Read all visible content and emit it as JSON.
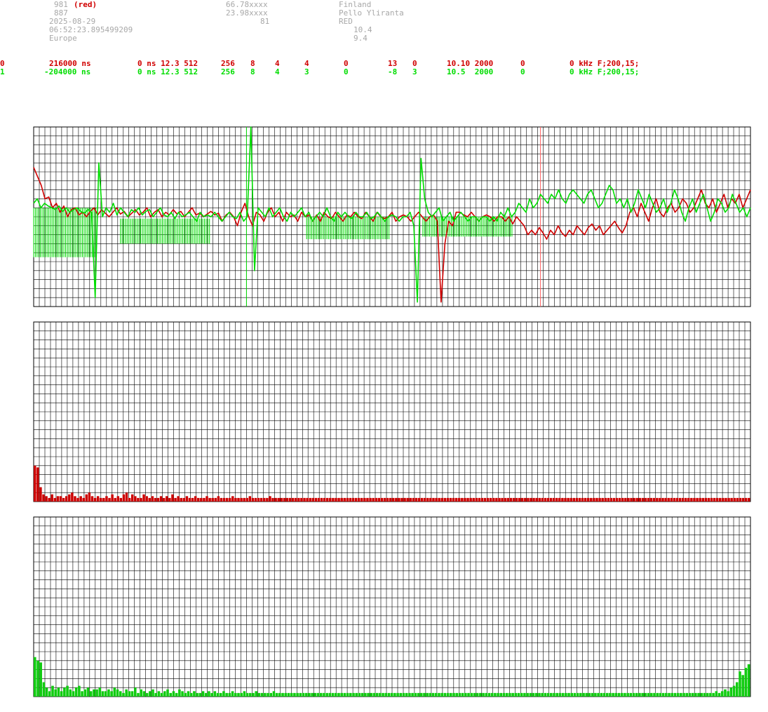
{
  "header": {
    "col1": [
      "981",
      "887",
      "2025-08-29",
      "06:52:23.895499209",
      "Europe"
    ],
    "red_tag": "(red)",
    "col2": [
      "66.78xxxx",
      "23.98xxxx",
      "81"
    ],
    "col3": [
      "Finland",
      "Pello Yliranta",
      "RED"
    ],
    "col3b": [
      "10.4",
      "9.4"
    ]
  },
  "channels": [
    {
      "id": "0",
      "offset": "216000 ns",
      "f1": "0 ns 12.3 512",
      "f2": "256",
      "f3": "8",
      "f4": "4",
      "f5": "4",
      "f6": "0",
      "f7": "13",
      "f8": "0",
      "f9": "10.10 2000",
      "f10": "0",
      "f11": "0 kHz F;200,15;",
      "color": "#d00000"
    },
    {
      "id": "1",
      "offset": "-204000 ns",
      "f1": "0 ns 12.3 512",
      "f2": "256",
      "f3": "8",
      "f4": "4",
      "f5": "3",
      "f6": "0",
      "f7": "-8",
      "f8": "3",
      "f9": "10.5  2000",
      "f10": "0",
      "f11": "0 kHz F;200,15;",
      "color": "#00dd00"
    }
  ],
  "chart_data": [
    {
      "type": "line",
      "ylim": [
        -1,
        1
      ],
      "xlim": [
        0,
        512
      ],
      "grid": true,
      "markers": {
        "red_x": 362,
        "green_x": 152
      },
      "series": [
        {
          "color": "#d00000",
          "values": [
            0.55,
            0.45,
            0.35,
            0.2,
            0.22,
            0.1,
            0.15,
            0.05,
            0.12,
            0.0,
            0.08,
            0.1,
            0.02,
            0.05,
            0.0,
            0.06,
            0.1,
            0.02,
            0.08,
            0.04,
            0.0,
            0.05,
            0.1,
            0.03,
            0.06,
            0.0,
            0.04,
            0.08,
            0.02,
            0.05,
            0.1,
            0.0,
            0.05,
            0.08,
            0.0,
            0.05,
            0.02,
            0.08,
            0.03,
            0.06,
            0.0,
            0.05,
            0.1,
            0.02,
            0.04,
            0.0,
            0.03,
            0.06,
            0.02,
            0.04,
            -0.05,
            0.02,
            0.05,
            0.0,
            -0.1,
            0.05,
            0.15,
            0.0,
            -0.1,
            0.05,
            0.02,
            -0.05,
            0.05,
            0.1,
            0.0,
            0.05,
            -0.05,
            0.05,
            0.0,
            0.02,
            -0.05,
            0.05,
            0.0,
            0.02,
            -0.05,
            0.02,
            -0.05,
            0.05,
            0.0,
            -0.02,
            0.05,
            0.0,
            -0.05,
            0.02,
            0.0,
            0.05,
            0.0,
            -0.02,
            0.05,
            0.0,
            -0.05,
            0.05,
            0.0,
            -0.02,
            0.0,
            0.05,
            -0.05,
            0.0,
            0.02,
            0.0,
            -0.05,
            0.0,
            0.05,
            0.0,
            -0.05,
            0.0,
            0.02,
            -0.05,
            -0.95,
            -0.3,
            -0.05,
            -0.1,
            0.05,
            0.05,
            0.02,
            0.0,
            0.05,
            0.0,
            -0.05,
            0.0,
            0.02,
            0.0,
            -0.05,
            0.0,
            0.0,
            -0.05,
            0.0,
            -0.08,
            0.0,
            -0.05,
            -0.1,
            -0.2,
            -0.15,
            -0.2,
            -0.12,
            -0.18,
            -0.25,
            -0.15,
            -0.2,
            -0.1,
            -0.18,
            -0.22,
            -0.15,
            -0.2,
            -0.1,
            -0.15,
            -0.2,
            -0.12,
            -0.08,
            -0.15,
            -0.1,
            -0.2,
            -0.15,
            -0.1,
            -0.05,
            -0.12,
            -0.18,
            -0.1,
            0.05,
            0.1,
            0.0,
            0.15,
            0.05,
            -0.05,
            0.1,
            0.2,
            0.05,
            0.0,
            0.1,
            0.15,
            0.05,
            0.1,
            0.2,
            0.15,
            0.05,
            0.1,
            0.2,
            0.3,
            0.15,
            0.1,
            0.2,
            0.05,
            0.15,
            0.25,
            0.1,
            0.2,
            0.15,
            0.25,
            0.1,
            0.2,
            0.3
          ]
        },
        {
          "color": "#00dd00",
          "values": [
            0.15,
            0.2,
            0.1,
            0.15,
            0.12,
            0.1,
            0.08,
            0.12,
            0.06,
            0.1,
            0.05,
            0.08,
            0.1,
            0.06,
            0.04,
            0.08,
            0.05,
            -0.9,
            0.6,
            0.0,
            0.1,
            0.05,
            0.15,
            0.02,
            0.1,
            0.05,
            0.0,
            0.08,
            0.05,
            0.1,
            0.02,
            0.06,
            0.08,
            0.0,
            0.05,
            0.1,
            0.02,
            0.0,
            0.05,
            -0.02,
            0.05,
            0.0,
            0.02,
            0.05,
            0.0,
            -0.05,
            0.05,
            0.0,
            0.02,
            0.0,
            0.05,
            0.0,
            -0.05,
            0.0,
            0.05,
            0.0,
            -0.02,
            0.05,
            -0.05,
            0.0,
            1.0,
            -0.6,
            0.1,
            0.05,
            0.0,
            0.1,
            0.0,
            0.05,
            0.1,
            0.0,
            -0.05,
            0.05,
            0.0,
            0.05,
            0.1,
            0.0,
            0.05,
            -0.05,
            0.0,
            0.05,
            0.0,
            0.1,
            0.0,
            -0.05,
            0.05,
            0.0,
            0.05,
            0.0,
            -0.02,
            0.05,
            0.0,
            0.0,
            0.05,
            -0.02,
            0.0,
            0.05,
            0.0,
            -0.05,
            0.0,
            0.02,
            0.0,
            -0.05,
            0.0,
            0.0,
            0.05,
            -0.1,
            -0.95,
            0.65,
            0.2,
            0.05,
            0.0,
            0.05,
            0.1,
            -0.05,
            0.0,
            0.05,
            -0.05,
            0.0,
            0.05,
            0.0,
            -0.05,
            0.0,
            0.0,
            -0.05,
            0.0,
            0.0,
            -0.05,
            0.0,
            -0.05,
            0.05,
            0.0,
            0.1,
            0.0,
            0.05,
            0.15,
            0.1,
            0.05,
            0.2,
            0.1,
            0.15,
            0.25,
            0.2,
            0.15,
            0.25,
            0.2,
            0.3,
            0.2,
            0.15,
            0.25,
            0.3,
            0.25,
            0.2,
            0.15,
            0.25,
            0.3,
            0.2,
            0.1,
            0.15,
            0.25,
            0.35,
            0.3,
            0.15,
            0.2,
            0.1,
            0.2,
            0.05,
            0.15,
            0.3,
            0.2,
            0.1,
            0.25,
            0.15,
            0.05,
            0.1,
            0.2,
            0.05,
            0.15,
            0.3,
            0.2,
            0.05,
            -0.05,
            0.1,
            0.2,
            0.05,
            0.15,
            0.25,
            0.1,
            -0.05,
            0.05,
            0.2,
            0.15,
            0.05,
            0.1,
            0.25,
            0.15,
            0.05,
            0.1,
            0.0,
            0.1
          ]
        }
      ],
      "bursts": [
        {
          "color": "#00dd00",
          "from": 0,
          "to": 45,
          "lo": -0.45,
          "hi": 0.1
        },
        {
          "color": "#00dd00",
          "from": 62,
          "to": 126,
          "lo": -0.3,
          "hi": -0.02
        },
        {
          "color": "#00dd00",
          "from": 195,
          "to": 254,
          "lo": -0.25,
          "hi": 0.0
        },
        {
          "color": "#00dd00",
          "from": 278,
          "to": 342,
          "lo": -0.22,
          "hi": 0.0
        }
      ]
    },
    {
      "type": "bar",
      "ylim": [
        0,
        1
      ],
      "grid": true,
      "color": "#cc0000",
      "values": [
        0.2,
        0.19,
        0.08,
        0.04,
        0.03,
        0.02,
        0.04,
        0.02,
        0.03,
        0.03,
        0.02,
        0.03,
        0.04,
        0.05,
        0.03,
        0.02,
        0.03,
        0.02,
        0.04,
        0.05,
        0.03,
        0.02,
        0.03,
        0.02,
        0.02,
        0.03,
        0.02,
        0.04,
        0.02,
        0.03,
        0.02,
        0.04,
        0.05,
        0.02,
        0.04,
        0.03,
        0.02,
        0.02,
        0.04,
        0.03,
        0.02,
        0.03,
        0.02,
        0.02,
        0.03,
        0.02,
        0.03,
        0.02,
        0.04,
        0.02,
        0.03,
        0.02,
        0.02,
        0.03,
        0.02,
        0.02,
        0.03,
        0.02,
        0.02,
        0.02,
        0.03,
        0.02,
        0.02,
        0.02,
        0.03,
        0.02,
        0.02,
        0.02,
        0.02,
        0.03,
        0.02,
        0.02,
        0.02,
        0.02,
        0.02,
        0.03,
        0.02,
        0.02,
        0.02,
        0.02,
        0.02,
        0.02,
        0.03,
        0.02,
        0.02,
        0.02,
        0.02,
        0.02,
        0.02,
        0.02,
        0.02,
        0.02,
        0.02,
        0.02,
        0.02,
        0.02,
        0.02,
        0.02,
        0.02,
        0.02,
        0.02,
        0.02,
        0.02,
        0.02,
        0.02,
        0.02,
        0.02,
        0.02,
        0.02,
        0.02,
        0.02,
        0.02,
        0.02,
        0.02,
        0.02,
        0.02,
        0.02,
        0.02,
        0.02,
        0.02,
        0.02,
        0.02,
        0.02,
        0.02,
        0.02,
        0.02,
        0.02,
        0.02,
        0.02,
        0.02,
        0.02,
        0.02,
        0.02,
        0.02,
        0.02,
        0.02,
        0.02,
        0.02,
        0.02,
        0.02,
        0.02,
        0.02,
        0.02,
        0.02,
        0.02,
        0.02,
        0.02,
        0.02,
        0.02,
        0.02,
        0.02,
        0.02,
        0.02,
        0.02,
        0.02,
        0.02,
        0.02,
        0.02,
        0.02,
        0.02,
        0.02,
        0.02,
        0.02,
        0.02,
        0.02,
        0.02,
        0.02,
        0.02,
        0.02,
        0.02,
        0.02,
        0.02,
        0.02,
        0.02,
        0.02,
        0.02,
        0.02,
        0.02,
        0.02,
        0.02,
        0.02,
        0.02,
        0.02,
        0.02,
        0.02,
        0.02,
        0.02,
        0.02,
        0.02,
        0.02,
        0.02,
        0.02,
        0.02,
        0.02,
        0.02,
        0.02,
        0.02,
        0.02,
        0.02,
        0.02,
        0.02,
        0.02,
        0.02,
        0.02,
        0.02,
        0.02,
        0.02,
        0.02,
        0.02,
        0.02,
        0.02,
        0.02,
        0.02,
        0.02,
        0.02,
        0.02,
        0.02,
        0.02,
        0.02,
        0.02,
        0.02,
        0.02,
        0.02,
        0.02,
        0.02,
        0.02,
        0.02,
        0.02,
        0.02,
        0.02,
        0.02,
        0.02,
        0.02,
        0.02,
        0.02,
        0.02,
        0.02,
        0.02,
        0.02,
        0.02,
        0.02,
        0.02,
        0.02,
        0.02,
        0.02,
        0.02,
        0.02,
        0.02,
        0.02,
        0.02
      ]
    },
    {
      "type": "bar",
      "ylim": [
        0,
        1
      ],
      "grid": true,
      "color": "#11cc11",
      "values": [
        0.22,
        0.2,
        0.19,
        0.08,
        0.05,
        0.03,
        0.06,
        0.04,
        0.05,
        0.03,
        0.05,
        0.06,
        0.04,
        0.03,
        0.05,
        0.06,
        0.03,
        0.04,
        0.05,
        0.03,
        0.04,
        0.04,
        0.05,
        0.03,
        0.03,
        0.04,
        0.03,
        0.05,
        0.04,
        0.03,
        0.02,
        0.04,
        0.03,
        0.03,
        0.05,
        0.02,
        0.04,
        0.03,
        0.02,
        0.03,
        0.04,
        0.02,
        0.03,
        0.02,
        0.03,
        0.04,
        0.02,
        0.03,
        0.02,
        0.04,
        0.03,
        0.02,
        0.03,
        0.02,
        0.03,
        0.02,
        0.02,
        0.03,
        0.02,
        0.03,
        0.02,
        0.03,
        0.02,
        0.02,
        0.03,
        0.02,
        0.02,
        0.03,
        0.02,
        0.02,
        0.02,
        0.03,
        0.02,
        0.02,
        0.02,
        0.03,
        0.02,
        0.02,
        0.02,
        0.02,
        0.02,
        0.03,
        0.02,
        0.02,
        0.02,
        0.02,
        0.02,
        0.02,
        0.02,
        0.02,
        0.02,
        0.02,
        0.02,
        0.02,
        0.02,
        0.02,
        0.02,
        0.02,
        0.02,
        0.02,
        0.02,
        0.02,
        0.02,
        0.02,
        0.02,
        0.02,
        0.02,
        0.02,
        0.02,
        0.02,
        0.02,
        0.02,
        0.02,
        0.02,
        0.02,
        0.02,
        0.02,
        0.02,
        0.02,
        0.02,
        0.02,
        0.02,
        0.02,
        0.02,
        0.02,
        0.02,
        0.02,
        0.02,
        0.02,
        0.02,
        0.02,
        0.02,
        0.02,
        0.02,
        0.02,
        0.02,
        0.02,
        0.02,
        0.02,
        0.02,
        0.02,
        0.02,
        0.02,
        0.02,
        0.02,
        0.02,
        0.02,
        0.02,
        0.02,
        0.02,
        0.02,
        0.02,
        0.02,
        0.02,
        0.02,
        0.02,
        0.02,
        0.02,
        0.02,
        0.02,
        0.02,
        0.02,
        0.02,
        0.02,
        0.02,
        0.02,
        0.02,
        0.02,
        0.02,
        0.02,
        0.02,
        0.02,
        0.02,
        0.02,
        0.02,
        0.02,
        0.02,
        0.02,
        0.02,
        0.02,
        0.02,
        0.02,
        0.02,
        0.02,
        0.02,
        0.02,
        0.02,
        0.02,
        0.02,
        0.02,
        0.02,
        0.02,
        0.02,
        0.02,
        0.02,
        0.02,
        0.02,
        0.02,
        0.02,
        0.02,
        0.02,
        0.02,
        0.02,
        0.02,
        0.02,
        0.02,
        0.02,
        0.02,
        0.02,
        0.02,
        0.02,
        0.02,
        0.02,
        0.02,
        0.02,
        0.02,
        0.02,
        0.02,
        0.02,
        0.02,
        0.02,
        0.02,
        0.02,
        0.02,
        0.02,
        0.02,
        0.02,
        0.02,
        0.02,
        0.02,
        0.02,
        0.03,
        0.02,
        0.03,
        0.04,
        0.03,
        0.05,
        0.06,
        0.08,
        0.14,
        0.12,
        0.16,
        0.18
      ]
    }
  ]
}
